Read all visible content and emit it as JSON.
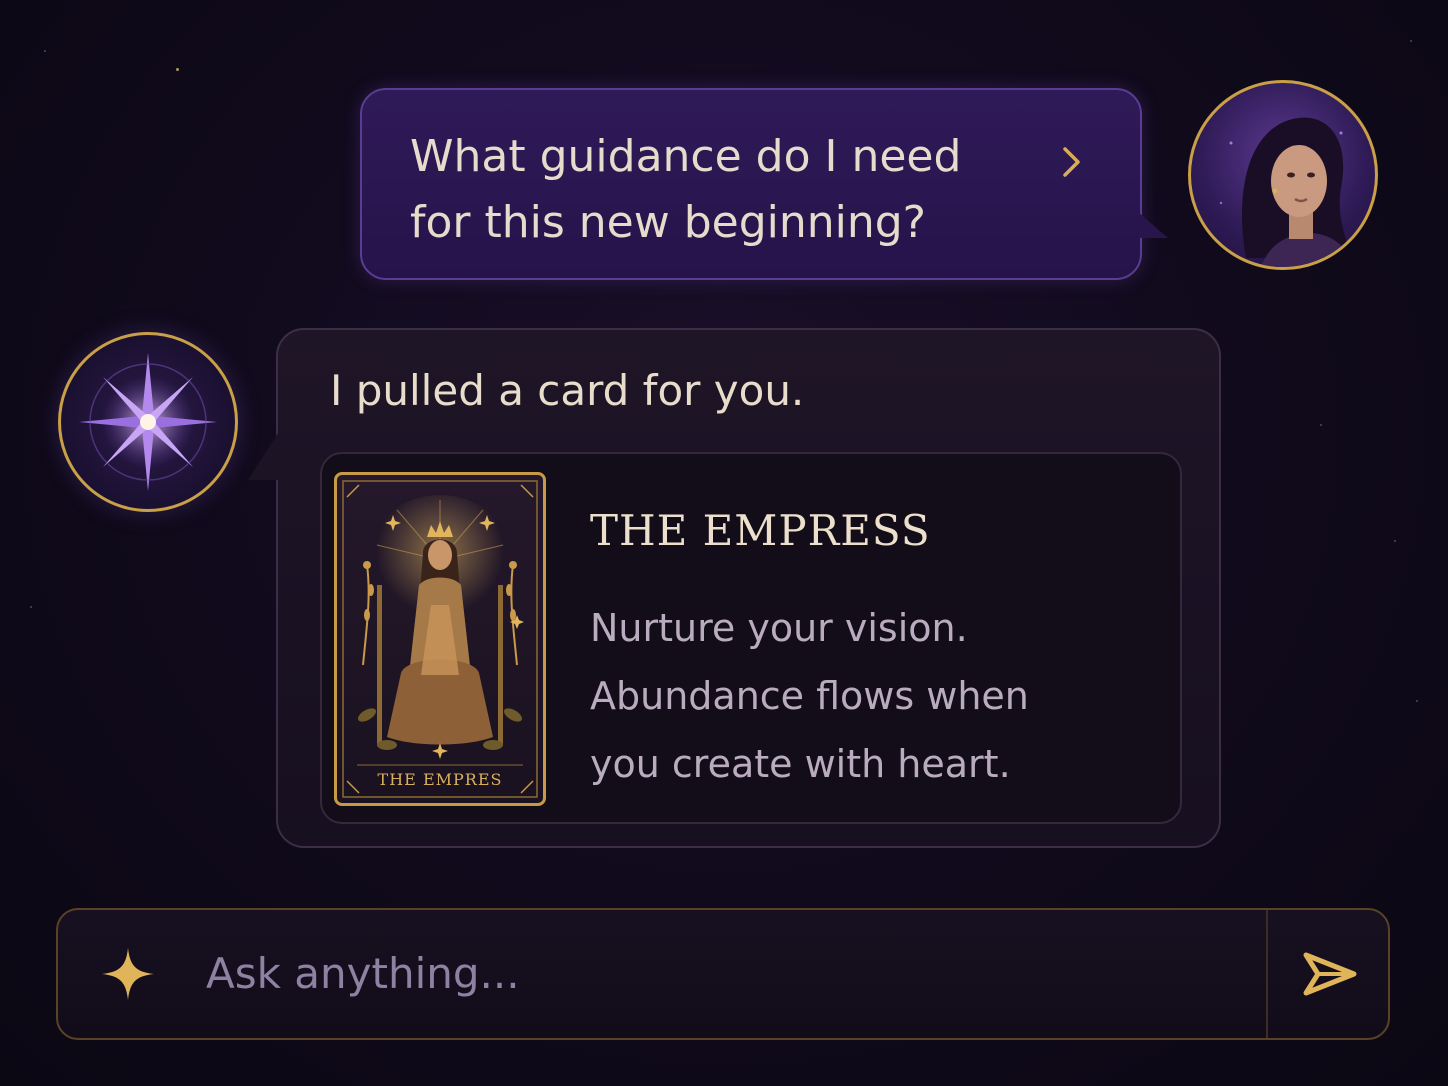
{
  "user_message": {
    "text": "What guidance do I need for this new beginning?"
  },
  "bot_message": {
    "intro": "I pulled a card for you.",
    "card": {
      "name": "THE EMPRESS",
      "card_caption": "THE EMPRES",
      "description": "Nurture your vision. Abundance flows when you create with heart."
    }
  },
  "composer": {
    "placeholder": "Ask anything..."
  },
  "icons": {
    "user_chevron": "chevron-right-icon",
    "composer_left": "sparkle-icon",
    "send": "send-icon",
    "bot_avatar": "compass-star-icon"
  },
  "colors": {
    "background": "#100a1b",
    "gold_accent": "#c9a048",
    "user_bubble": "#2f1a58",
    "bot_bubble": "#1e1527",
    "text_primary": "#e8dcc8",
    "text_muted": "#b9acbf"
  }
}
